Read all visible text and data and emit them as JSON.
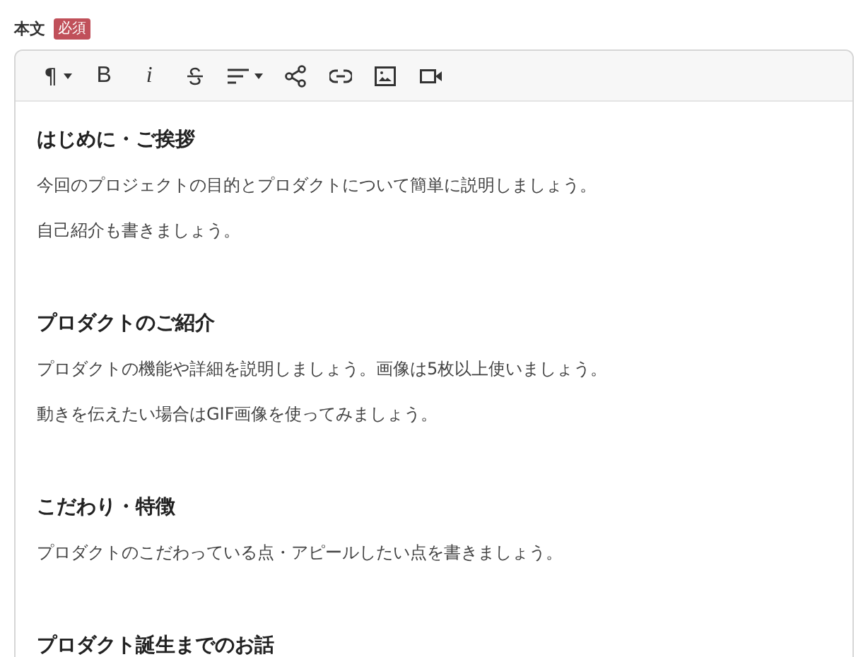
{
  "field": {
    "label": "本文",
    "badge": "必須"
  },
  "toolbar": {
    "paragraph": "¶",
    "bold": "B",
    "italic": "i"
  },
  "content": [
    {
      "kind": "heading",
      "text": "はじめに・ご挨拶"
    },
    {
      "kind": "paragraph",
      "text": "今回のプロジェクトの目的とプロダクトについて簡単に説明しましょう。"
    },
    {
      "kind": "paragraph",
      "text": "自己紹介も書きましょう。"
    },
    {
      "kind": "heading",
      "text": "プロダクトのご紹介"
    },
    {
      "kind": "paragraph",
      "text": "プロダクトの機能や詳細を説明しましょう。画像は5枚以上使いましょう。"
    },
    {
      "kind": "paragraph",
      "text": "動きを伝えたい場合はGIF画像を使ってみましょう。"
    },
    {
      "kind": "heading",
      "text": "こだわり・特徴"
    },
    {
      "kind": "paragraph",
      "text": "プロダクトのこだわっている点・アピールしたい点を書きましょう。"
    },
    {
      "kind": "heading",
      "text": "プロダクト誕生までのお話"
    }
  ]
}
